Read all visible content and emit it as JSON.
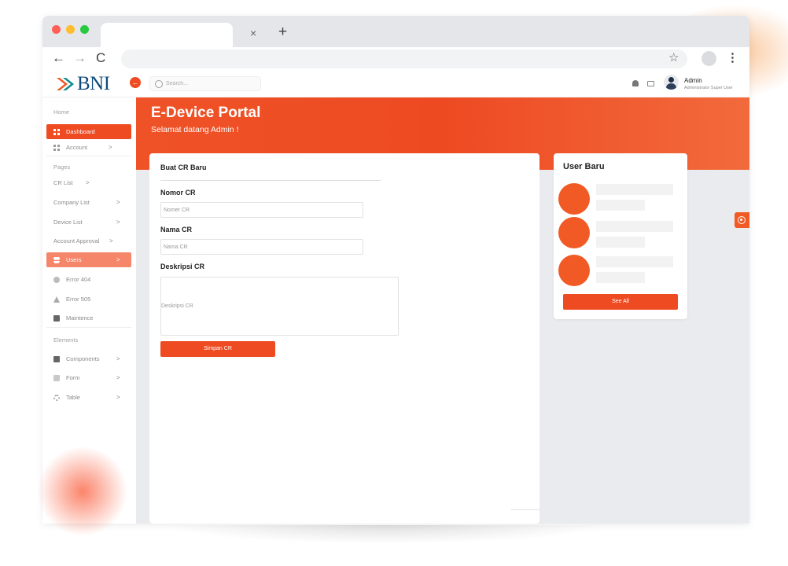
{
  "browser": {
    "tab_close": "×",
    "tab_new": "+",
    "back_icon": "←",
    "forward_icon": "→",
    "reload_icon": "C",
    "star_icon": "☆",
    "menu_icon": "⋮"
  },
  "header": {
    "logo_text": "BNI",
    "collapse_icon": "←",
    "search_placeholder": "Search...",
    "user_name": "Admin",
    "user_role": "Administrator Super User"
  },
  "sidebar": {
    "section_home": "Home",
    "item_dashboard": "Dashboard",
    "item_account": "Account",
    "section_pages": "Pages",
    "item_cr_list": "CR List",
    "item_company_list": "Company List",
    "item_device_list": "Device List",
    "item_account_approval": "Account Approval",
    "item_users": "Users",
    "item_error_404": "Error 404",
    "item_error_505": "Error 505",
    "item_maintenance": "Maintence",
    "section_elements": "Elements",
    "item_components": "Components",
    "item_form": "Form",
    "item_table": "Table",
    "chevron": ">"
  },
  "banner": {
    "title": "E-Device Portal",
    "subtitle": "Selamat datang Admin !"
  },
  "form": {
    "title": "Buat CR Baru",
    "nomor_label": "Nomor CR",
    "nomor_placeholder": "Nomer CR",
    "nama_label": "Nama CR",
    "nama_placeholder": "Nama CR",
    "deskripsi_label": "Deskripsi CR",
    "deskripsi_placeholder": "Deskripsi CR",
    "submit_label": "Simpan CR"
  },
  "user_card": {
    "title": "User Baru",
    "see_all_label": "See All"
  },
  "colors": {
    "accent": "#ee4b23",
    "brand_blue": "#0f4a7a",
    "brand_orange": "#f15a24"
  }
}
